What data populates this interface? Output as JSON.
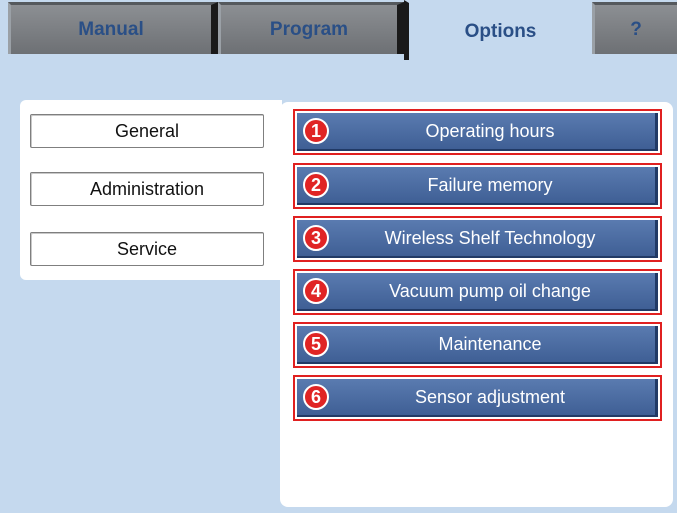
{
  "tabs": {
    "manual": "Manual",
    "program": "Program",
    "options": "Options",
    "help": "?"
  },
  "active_tab": "Options",
  "left_menu": {
    "general": "General",
    "administration": "Administration",
    "service": "Service"
  },
  "selected_menu": "Service",
  "service_items": [
    {
      "number": "1",
      "label": "Operating hours"
    },
    {
      "number": "2",
      "label": "Failure memory"
    },
    {
      "number": "3",
      "label": "Wireless Shelf Technology"
    },
    {
      "number": "4",
      "label": "Vacuum pump oil change"
    },
    {
      "number": "5",
      "label": "Maintenance"
    },
    {
      "number": "6",
      "label": "Sensor adjustment"
    }
  ],
  "colors": {
    "background": "#c5d9ee",
    "tab_text": "#2a4f86",
    "button_blue": "#4a6ba3",
    "highlight_red": "#e02020"
  }
}
